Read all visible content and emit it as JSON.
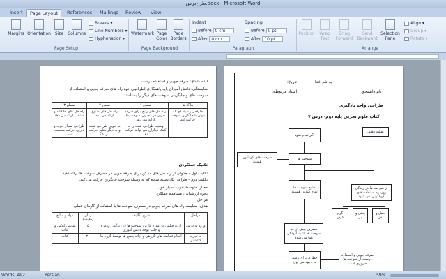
{
  "window": {
    "title": "طرح‌درس.docx - Microsoft Word"
  },
  "ribbon_tabs": [
    "Insert",
    "Page Layout",
    "References",
    "Mailings",
    "Review",
    "View"
  ],
  "active_tab": "Page Layout",
  "ribbon": {
    "page_setup": {
      "margins": "Margins",
      "orientation": "Orientation",
      "size": "Size",
      "columns": "Columns",
      "breaks": "Breaks",
      "line_numbers": "Line Numbers",
      "hyphenation": "Hyphenation",
      "label": "Page Setup"
    },
    "page_background": {
      "watermark": "Watermark",
      "page_color": "Page Color",
      "page_borders": "Page Borders",
      "label": "Page Background"
    },
    "paragraph": {
      "indent_title": "Indent",
      "spacing_title": "Spacing",
      "before_label": "Before",
      "after_label": "After",
      "indent_before": "0 cm",
      "indent_after": "0 cm",
      "spacing_before": "0 pt",
      "spacing_after": "10 pt",
      "label": "Paragraph"
    },
    "arrange": {
      "position": "Position",
      "wrap_text": "Wrap Text",
      "bring_forward": "Bring Forward",
      "send_backward": "Send Backward",
      "selection_pane": "Selection Pane",
      "align": "Align",
      "group": "Group",
      "rotate": "Rotate",
      "label": "Arrange"
    }
  },
  "left_page": {
    "lines": [
      "ایده کلیدی: صرفه جویی و استفاده درست",
      "شایستگی: دانش آموزان پایه یاهمکاری لطرافیان خود راه های صرفه جویی و استفاده از",
      "سوخت های و جایگزینی سوخت های دیگر را بشناسند",
      "تکنیک عملکردی:",
      "تکلیف اول - جدولی از راه حل های ممکن برای صرفه جویی در مصرف سوخت ها ارائه دهید.",
      "تکلیف دوم - طراحی یک دسته ساده که به وسیله سوخت جایگزین حرکت می کند.",
      "معیار: متوسط خوب بسیار خوب",
      "نحوه ارزشیابی: مشاهده عملکرد",
      "مراحل",
      "هدف: مقایسه راه های صرفه جویی در مصرف سوخت ها با استفاده از کارهای عملی"
    ],
    "rubric_headers": [
      "ملاک ها",
      "سطح ۱",
      "سطح ۲",
      "سطح ۳"
    ],
    "rubric_rows": [
      [
        "طراحی وسیله ای که بتوان با جایگزین سوخت حرکت کند",
        "راه حل های رایج برای صرفه جویی در مصرف سوخت ها ارائه می دهد",
        "راه حل های متنوع ارائه می دهد",
        "راه حل های خلاقانه و منتخب ارائه می دهد"
      ],
      [
        "",
        "وسیله طراحی شده را به کمک دیگران می تواند حرکت دهد",
        "به خوبی طراحی شده و به دیگر منابع حرکت می کند",
        "طراحی بسیار خوب و دارای حرکت مناسب است"
      ]
    ],
    "steps_headers": [
      "مراحل",
      "شرح تکالیف",
      "زمان (دقیقه)",
      "مواد و منابع"
    ],
    "steps_rows": [
      [
        "ورود به درس",
        "ارائه فیلمی در مورد کاربرد سوخت ها در زندگی روزمره و جلب توجه دانش آموزان",
        "۵",
        "نمایش کلاس و کتاب"
      ],
      [
        "به تجربه گذاشتن",
        "انجام فعالیت های گروهی و ارائه پاسخ ها توسط گروه ها",
        "۲۰",
        "کتاب"
      ]
    ]
  },
  "right_page": {
    "header_right": "نام دانشجو:",
    "header_date": "تاریخ:",
    "header_name": "به نام خدا",
    "header_teacher": "استاد مربوطه:",
    "title_design": "طراحی واحد یادگیری",
    "book_title": "کتاب علوم تجربی پایه دوم- درس ۷",
    "flowchart": {
      "concept_map": "نقشه ذهنی",
      "start": "اگر تمام شود",
      "fuels": "سوخت ها",
      "alt_fuels": "سوخت های گوناگون هستند",
      "sources": "منابع سوخت ها تمام شدنی هستند",
      "daily_use": "از سوخت ها در زندگی روزمره استفاده های گوناگونی می شود",
      "use_1": "گرم کردن",
      "use_2": "پختن و پز",
      "use_3": "حمل و نقل",
      "excess": "مصرف بیش از حد سوخت ها باعث آلودگی هوا می شود",
      "harm": "خطری برای زمین به وجود می آورد",
      "saving": "صرفه جویی و استفاده درست از سوخت ها ضروری است"
    }
  },
  "status": {
    "words": "Words: 492",
    "language": "Persian",
    "zoom": "59%"
  }
}
